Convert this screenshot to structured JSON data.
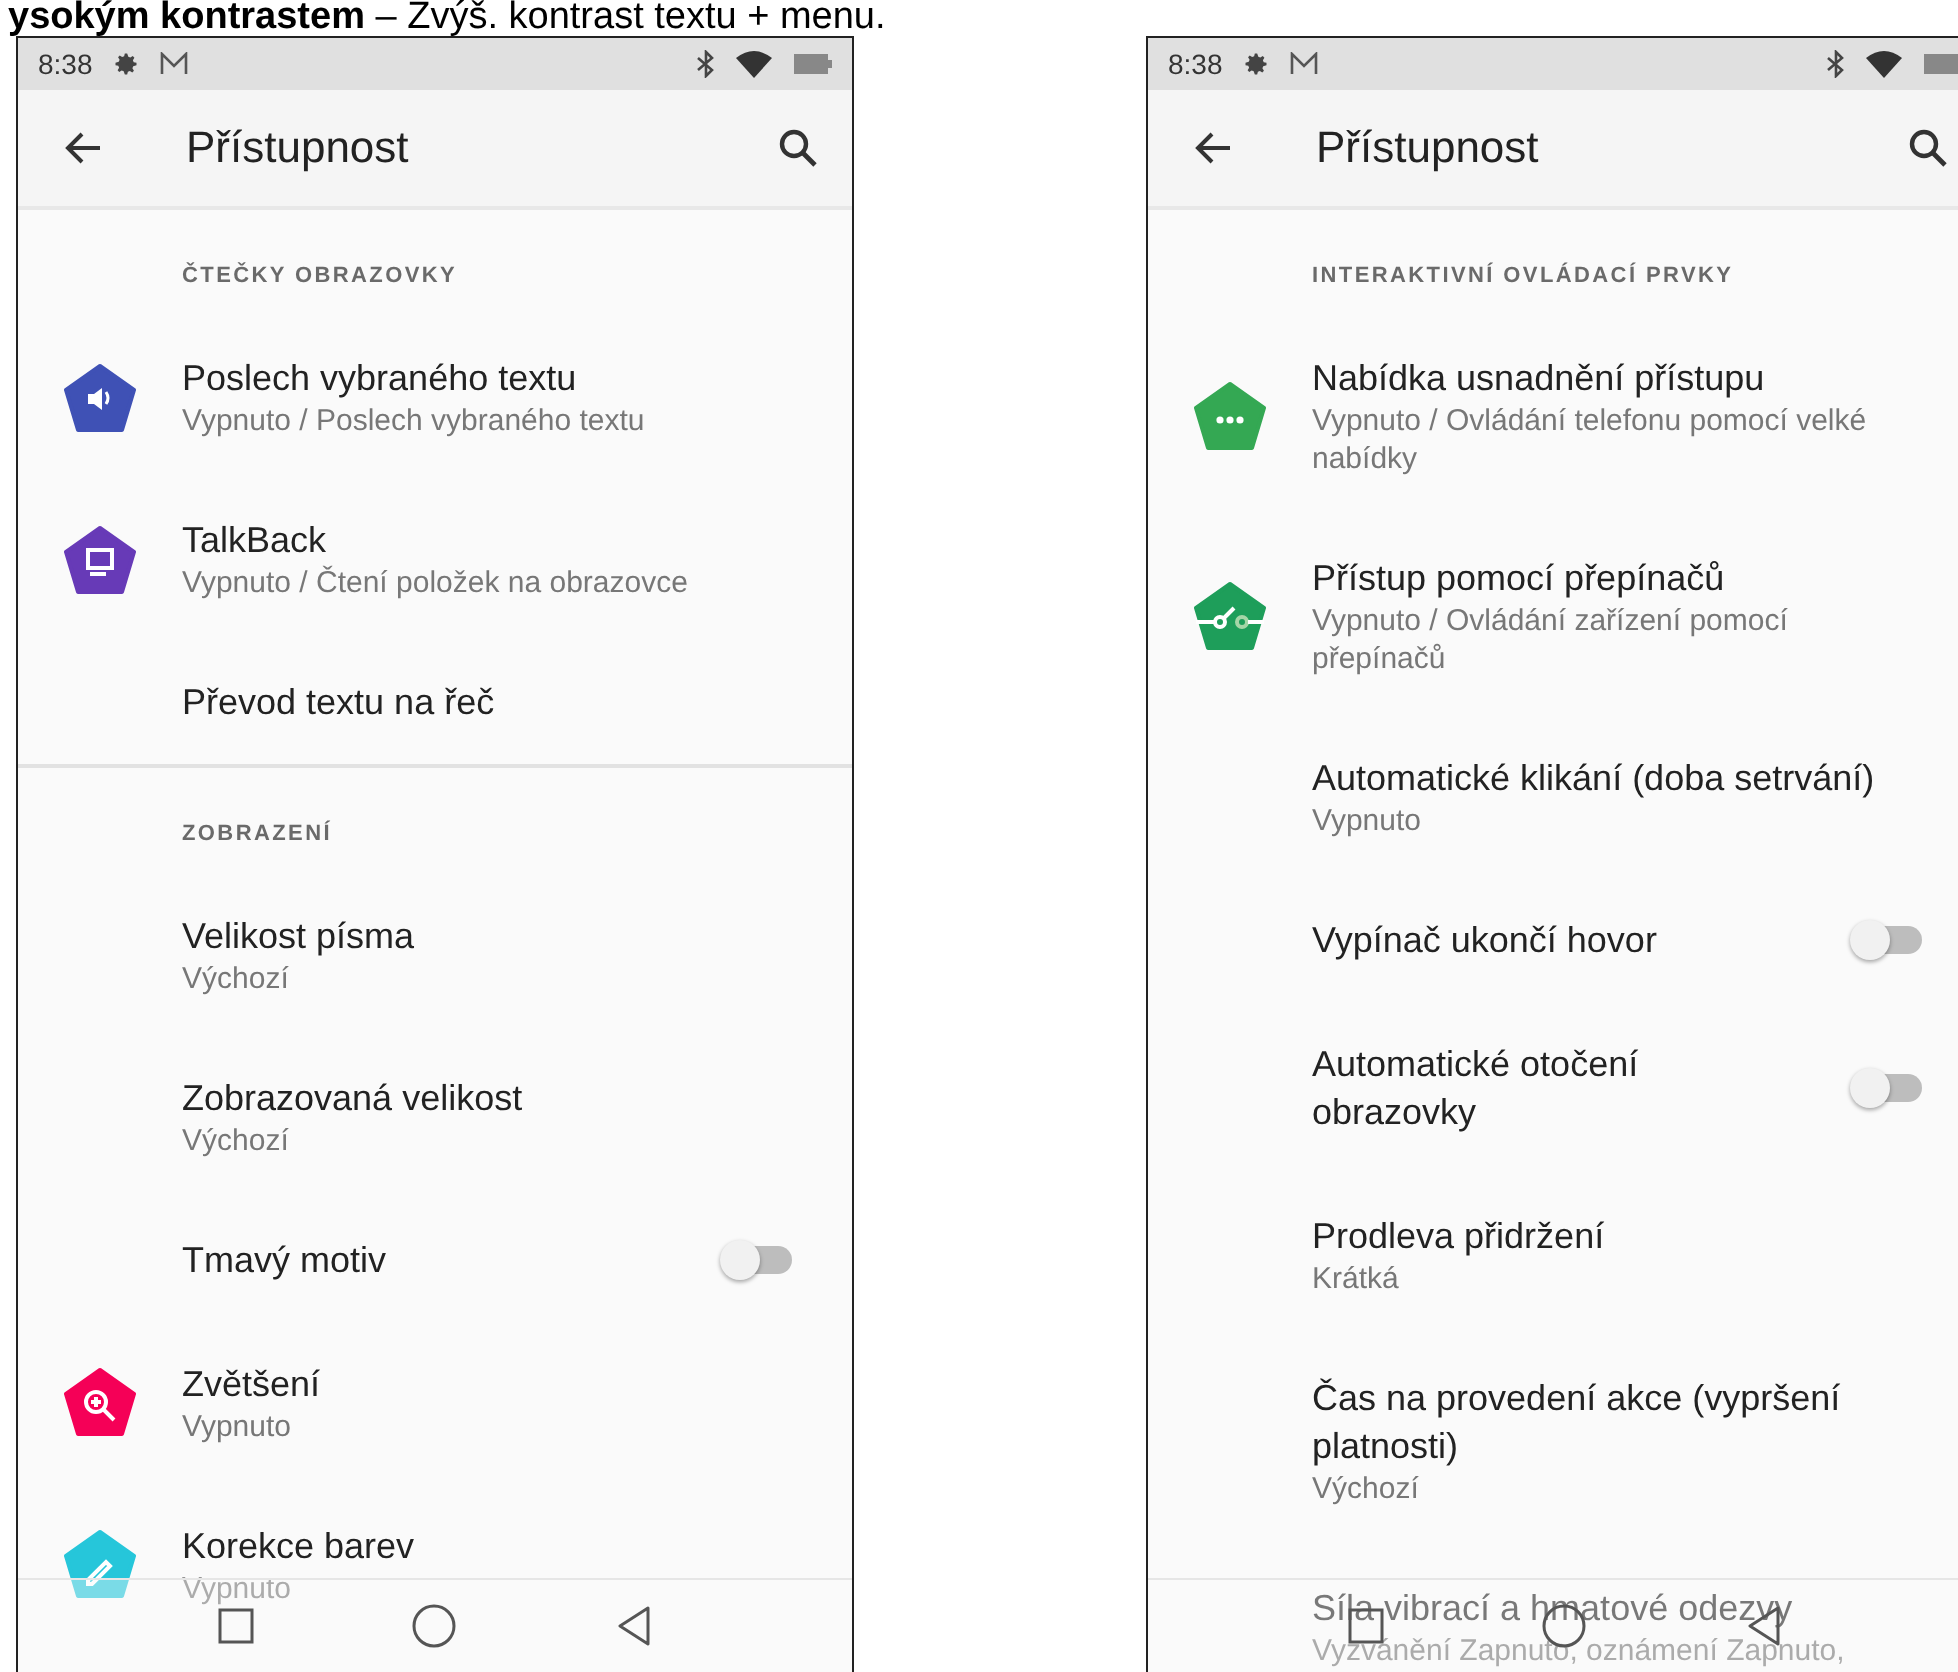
{
  "caption": "**ysokým kontrastem** – Zvýš. kontrast textu + menu.",
  "phones": [
    {
      "status_time": "8:38",
      "title": "Přístupnost",
      "items": [
        {
          "kind": "header",
          "label": "ČTEČKY OBRAZOVKY"
        },
        {
          "kind": "item",
          "title": "Poslech vybraného textu",
          "subtitle": "Vypnuto / Poslech vybraného textu",
          "color": "#3f51b5"
        },
        {
          "kind": "item",
          "title": "TalkBack",
          "subtitle": "Vypnuto / Čtení položek na obrazovce",
          "color": "#673ab7"
        },
        {
          "kind": "item",
          "title": "Převod textu na řeč"
        },
        {
          "kind": "divider"
        },
        {
          "kind": "header",
          "label": "ZOBRAZENÍ"
        },
        {
          "kind": "item",
          "title": "Velikost písma",
          "subtitle": "Výchozí"
        },
        {
          "kind": "item",
          "title": "Zobrazovaná velikost",
          "subtitle": "Výchozí"
        },
        {
          "kind": "toggle",
          "title": "Tmavý motiv",
          "on": false
        },
        {
          "kind": "item",
          "title": "Zvětšení",
          "subtitle": "Vypnuto",
          "color": "#f50057"
        },
        {
          "kind": "item",
          "title": "Korekce barev",
          "subtitle": "Vypnuto",
          "color": "#26c6da"
        }
      ]
    },
    {
      "status_time": "8:38",
      "title": "Přístupnost",
      "items": [
        {
          "kind": "header",
          "label": "INTERAKTIVNÍ OVLÁDACÍ PRVKY"
        },
        {
          "kind": "item",
          "title": "Nabídka usnadnění přístupu",
          "subtitle": "Vypnuto / Ovládání telefonu pomocí velké nabídky",
          "color": "#34a853"
        },
        {
          "kind": "item",
          "title": "Přístup pomocí přepínačů",
          "subtitle": "Vypnuto / Ovládání zařízení pomocí přepínačů",
          "color": "#1e9e5a"
        },
        {
          "kind": "item",
          "title": "Automatické klikání (doba setrvání)",
          "subtitle": "Vypnuto"
        },
        {
          "kind": "toggle",
          "title": "Vypínač ukončí hovor",
          "on": false
        },
        {
          "kind": "toggle",
          "title": "Automatické otočení obrazovky",
          "on": false
        },
        {
          "kind": "item",
          "title": "Prodleva přidržení",
          "subtitle": "Krátká"
        },
        {
          "kind": "item",
          "title": "Čas na provedení akce (vypršení platnosti)",
          "subtitle": "Výchozí"
        },
        {
          "kind": "item",
          "title": "Síla vibrací a hmatové odezvy",
          "subtitle": "Vyzvánění Zapnuto, oznámení Zapnuto,"
        }
      ]
    }
  ]
}
